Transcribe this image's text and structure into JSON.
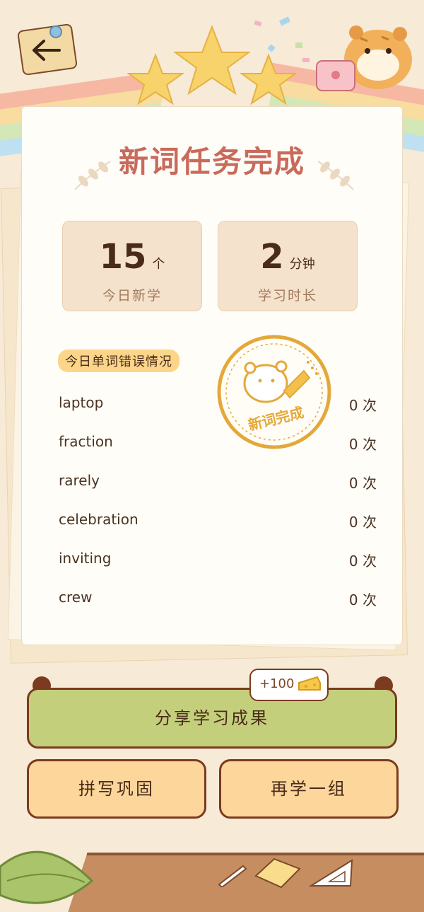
{
  "header": {
    "title": "新词任务完成"
  },
  "stats": [
    {
      "value": "15",
      "unit": "个",
      "label": "今日新学"
    },
    {
      "value": "2",
      "unit": "分钟",
      "label": "学习时长"
    }
  ],
  "errors_section": {
    "label": "今日单词错误情况",
    "stamp_text": "新词完成",
    "words": [
      {
        "word": "laptop",
        "count": "0 次"
      },
      {
        "word": "fraction",
        "count": "0 次"
      },
      {
        "word": "rarely",
        "count": "0 次"
      },
      {
        "word": "celebration",
        "count": "0 次"
      },
      {
        "word": "inviting",
        "count": "0 次"
      },
      {
        "word": "crew",
        "count": "0 次"
      }
    ]
  },
  "actions": {
    "share_label": "分享学习成果",
    "reward_badge": "+100",
    "spell_label": "拼写巩固",
    "again_label": "再学一组"
  },
  "colors": {
    "title": "#c96a5b",
    "share_button": "#c4cf7c",
    "secondary_button": "#fcd69a",
    "button_border": "#7a3b1e",
    "stamp": "#e4a83a"
  }
}
